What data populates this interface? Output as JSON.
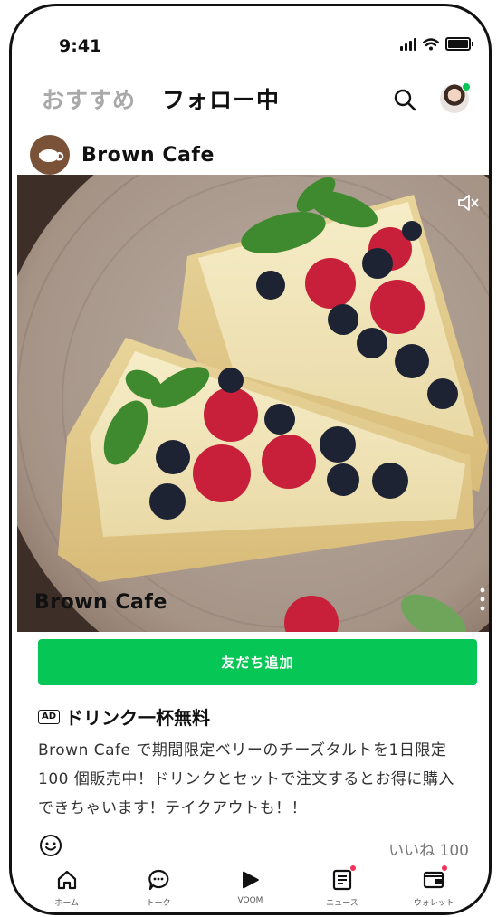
{
  "status_bar": {
    "time": "9:41"
  },
  "header": {
    "tabs": [
      {
        "label": "おすすめ",
        "active": false
      },
      {
        "label": "フォロー中",
        "active": true
      }
    ]
  },
  "post": {
    "account_name": "Brown Cafe",
    "media_caption": "Brown Cafe",
    "cta_label": "友だち追加",
    "ad_badge": "AD",
    "ad_title": "ドリンク一杯無料",
    "body_lines": [
      "Brown Cafe で期間限定ベリーのチーズタルトを1日限定",
      "100 個販売中！ドリンクとセットで注文するとお得に購入",
      "できちゃいます！テイクアウトも！！"
    ],
    "like_label": "いいね 100"
  },
  "bottom_nav": {
    "items": [
      {
        "label": "ホーム",
        "icon": "home-icon",
        "badge": false
      },
      {
        "label": "トーク",
        "icon": "chat-icon",
        "badge": false
      },
      {
        "label": "VOOM",
        "icon": "voom-icon",
        "badge": false
      },
      {
        "label": "ニュース",
        "icon": "news-icon",
        "badge": true
      },
      {
        "label": "ウォレット",
        "icon": "wallet-icon",
        "badge": true
      }
    ]
  },
  "colors": {
    "accent": "#06c755",
    "badge": "#f2315a",
    "inactive_tab": "#a9a9a9"
  }
}
